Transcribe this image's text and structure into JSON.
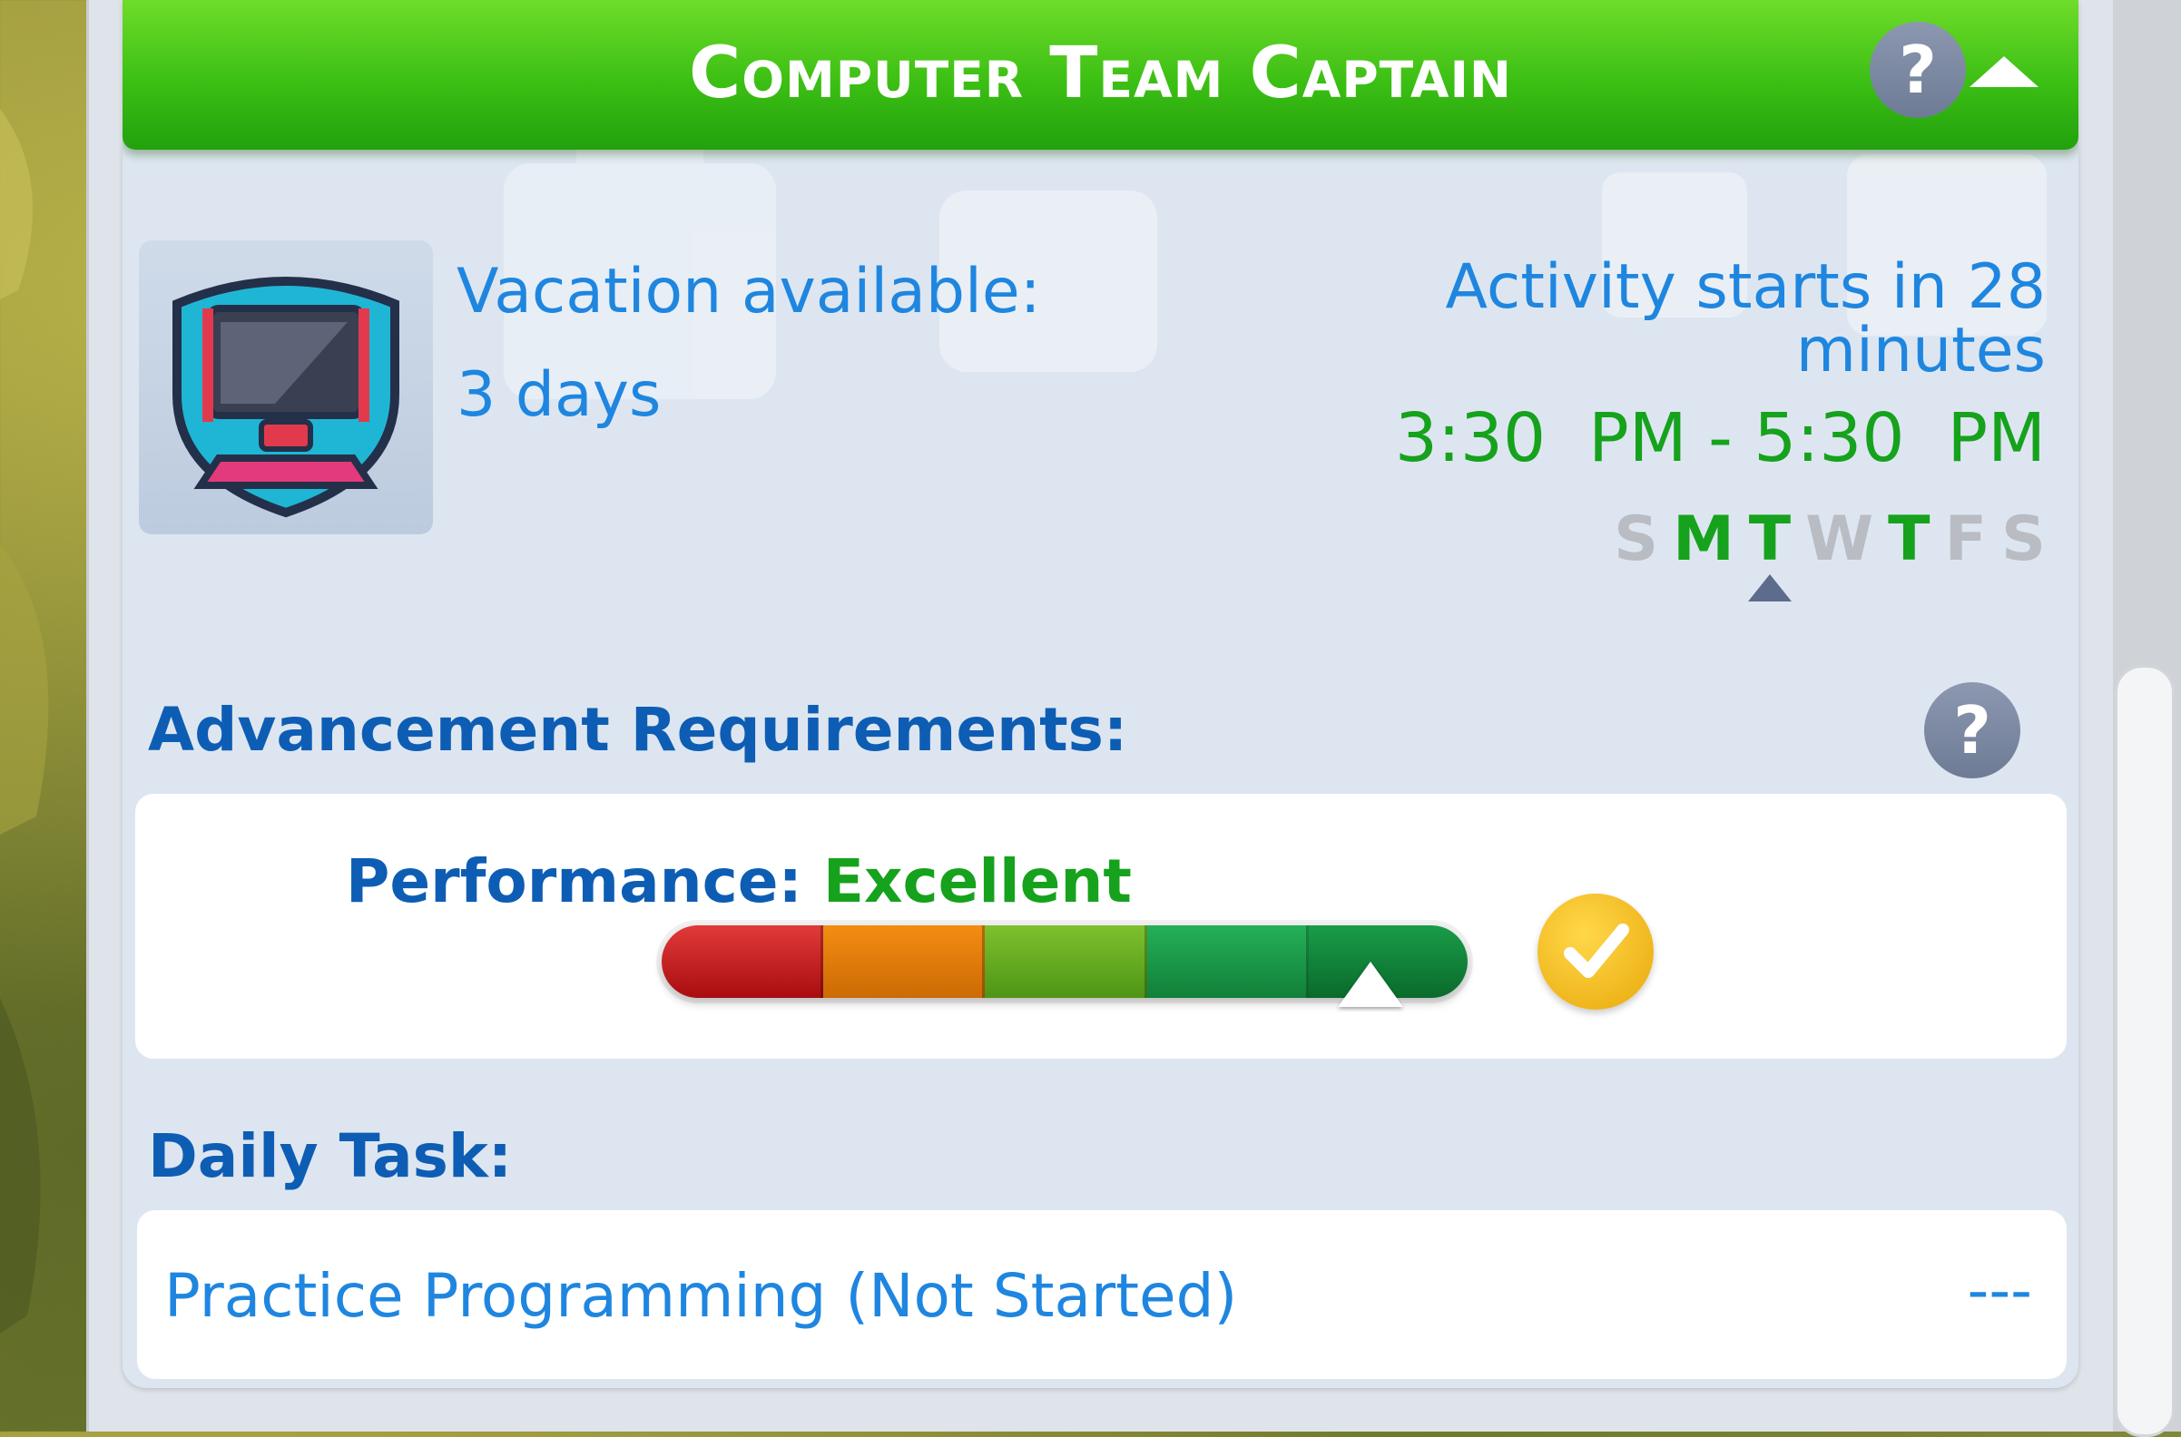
{
  "career_panel": {
    "title": "Computer Team Captain",
    "help_symbol": "?",
    "vacation": {
      "label": "Vacation available:",
      "value": "3 days"
    },
    "activity": {
      "starts_text": "Activity starts in 28 minutes",
      "time_range": "3:30  PM - 5:30  PM",
      "days": [
        {
          "letter": "S",
          "active": false
        },
        {
          "letter": "M",
          "active": true
        },
        {
          "letter": "T",
          "active": true
        },
        {
          "letter": "W",
          "active": false
        },
        {
          "letter": "T",
          "active": true
        },
        {
          "letter": "F",
          "active": false
        },
        {
          "letter": "S",
          "active": false
        }
      ],
      "today_index": 2
    },
    "advancement": {
      "label": "Advancement Requirements:",
      "help_symbol": "?",
      "performance_label": "Performance:",
      "performance_value": "Excellent",
      "performance_level": 0.88,
      "met": true
    },
    "daily_task": {
      "label": "Daily Task:",
      "name": "Practice Programming (Not Started)",
      "status": "---"
    }
  },
  "icons": {
    "career": "computer-team-badge-icon",
    "help": "help-icon",
    "collapse": "collapse-arrow-icon",
    "check": "checkmark-icon"
  },
  "colors": {
    "header_green": "#3cbf14",
    "text_blue": "#1f86e0",
    "heading_blue": "#0e5db4",
    "active_green": "#16a21c",
    "inactive_gray": "#b9bcc2",
    "check_gold": "#f0b414"
  }
}
